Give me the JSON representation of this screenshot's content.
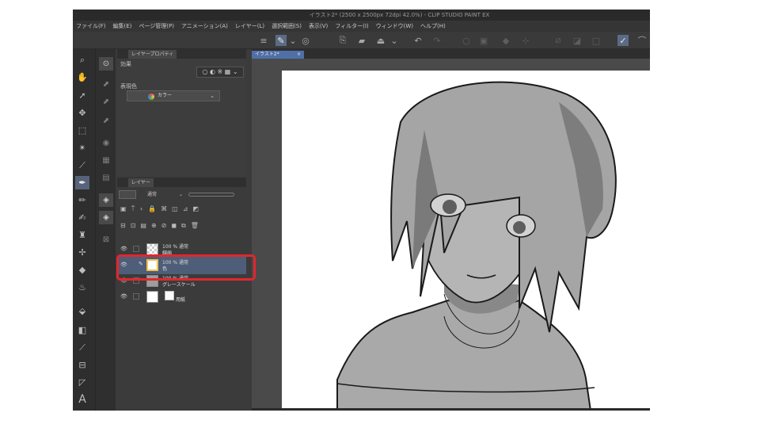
{
  "window": {
    "title": "イラスト2* (2500 x 2500px 72dpi 42.0%)  - CLIP STUDIO PAINT EX"
  },
  "menu": [
    "ファイル(F)",
    "編集(E)",
    "ページ管理(P)",
    "アニメーション(A)",
    "レイヤー(L)",
    "選択範囲(S)",
    "表示(V)",
    "フィルター(I)",
    "ウィンドウ(W)",
    "ヘルプ(H)"
  ],
  "icons": {
    "commandbar": [
      "menu-icon",
      "new-icon",
      "dropdown-icon",
      "clip-studio-icon",
      "new-file-icon",
      "open-icon",
      "save-icon",
      "dropdown-icon",
      "undo-icon",
      "redo-icon",
      "clear-icon",
      "fill-icon",
      "transform-icon",
      "deselect-icon",
      "invert-icon",
      "border-icon",
      "checkmark-icon",
      "ruler-icon"
    ],
    "toolbar": [
      "zoom-icon",
      "hand-icon",
      "operation-icon",
      "move-icon",
      "selection-icon",
      "auto-select-icon",
      "eyedropper-icon",
      "pen-icon",
      "pencil-icon",
      "brush-icon",
      "airbrush-icon",
      "decoration-icon",
      "eraser-icon",
      "blend-icon",
      "fill-icon",
      "gradient-icon",
      "figure-icon",
      "frame-icon",
      "ruler-icon",
      "text-icon"
    ]
  },
  "layer_property": {
    "tab": "レイヤープロパティ",
    "effect_label": "効果",
    "expression_label": "表現色",
    "color_value": "カラー"
  },
  "layer_panel": {
    "tab": "レイヤー",
    "blend_mode": "通常",
    "layers": [
      {
        "percent": "100 % 通常",
        "name": "線画"
      },
      {
        "percent": "100 % 通常",
        "name": "色"
      },
      {
        "percent": "100 % 通常",
        "name": "グレースケール"
      },
      {
        "percent": "",
        "name": "用紙"
      }
    ]
  },
  "canvas": {
    "tab": "イラスト2*",
    "tab_close": "×"
  }
}
